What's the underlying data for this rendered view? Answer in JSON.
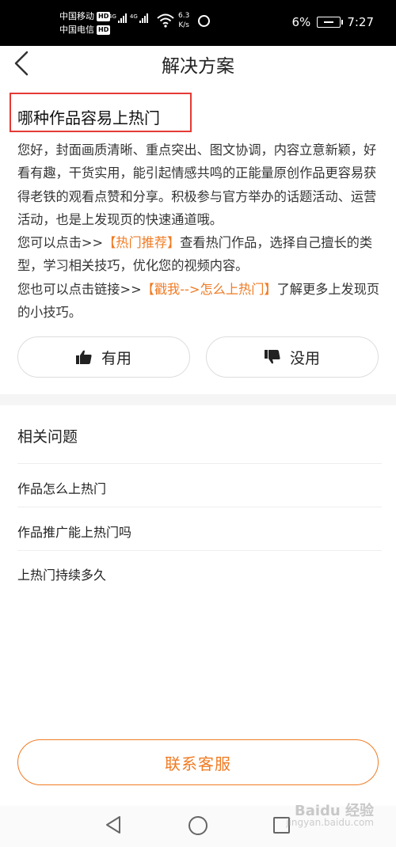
{
  "status_bar": {
    "carrier_1": "中国移动",
    "carrier_2": "中国电信",
    "hd_badge": "HD",
    "network_type": "4G",
    "speed_value": "6.3",
    "speed_unit": "K/s",
    "battery": "6%",
    "time": "7:27"
  },
  "header": {
    "title": "解决方案"
  },
  "question": {
    "title": "哪种作品容易上热门"
  },
  "answer": {
    "text_1": "您好，封面画质清晰、重点突出、图文协调，内容立意新颖，好看有趣，干货实用，能引起情感共鸣的正能量原创作品更容易获得老铁的观看点赞和分享。积极参与官方举办的话题活动、运营活动，也是上发现页的快速通道哦。",
    "text_2": "您可以点击>>",
    "link_1": "【热门推荐】",
    "text_3": "查看热门作品，选择自己擅长的类型，学习相关技巧，优化您的视频内容。",
    "text_4": "您也可以点击链接>>",
    "link_2": "【戳我-->怎么上热门】",
    "text_5": "了解更多上发现页的小技巧。"
  },
  "feedback": {
    "useful_label": "有用",
    "useless_label": "没用"
  },
  "related": {
    "title": "相关问题",
    "items": [
      {
        "label": "作品怎么上热门"
      },
      {
        "label": "作品推广能上热门吗"
      },
      {
        "label": "上热门持续多久"
      }
    ]
  },
  "contact": {
    "label": "联系客服"
  },
  "watermark": {
    "line_1": "Baidu 经验",
    "line_2": "jingyan.baidu.com"
  },
  "colors": {
    "accent": "#f07b23",
    "highlight_box": "#e53935"
  }
}
